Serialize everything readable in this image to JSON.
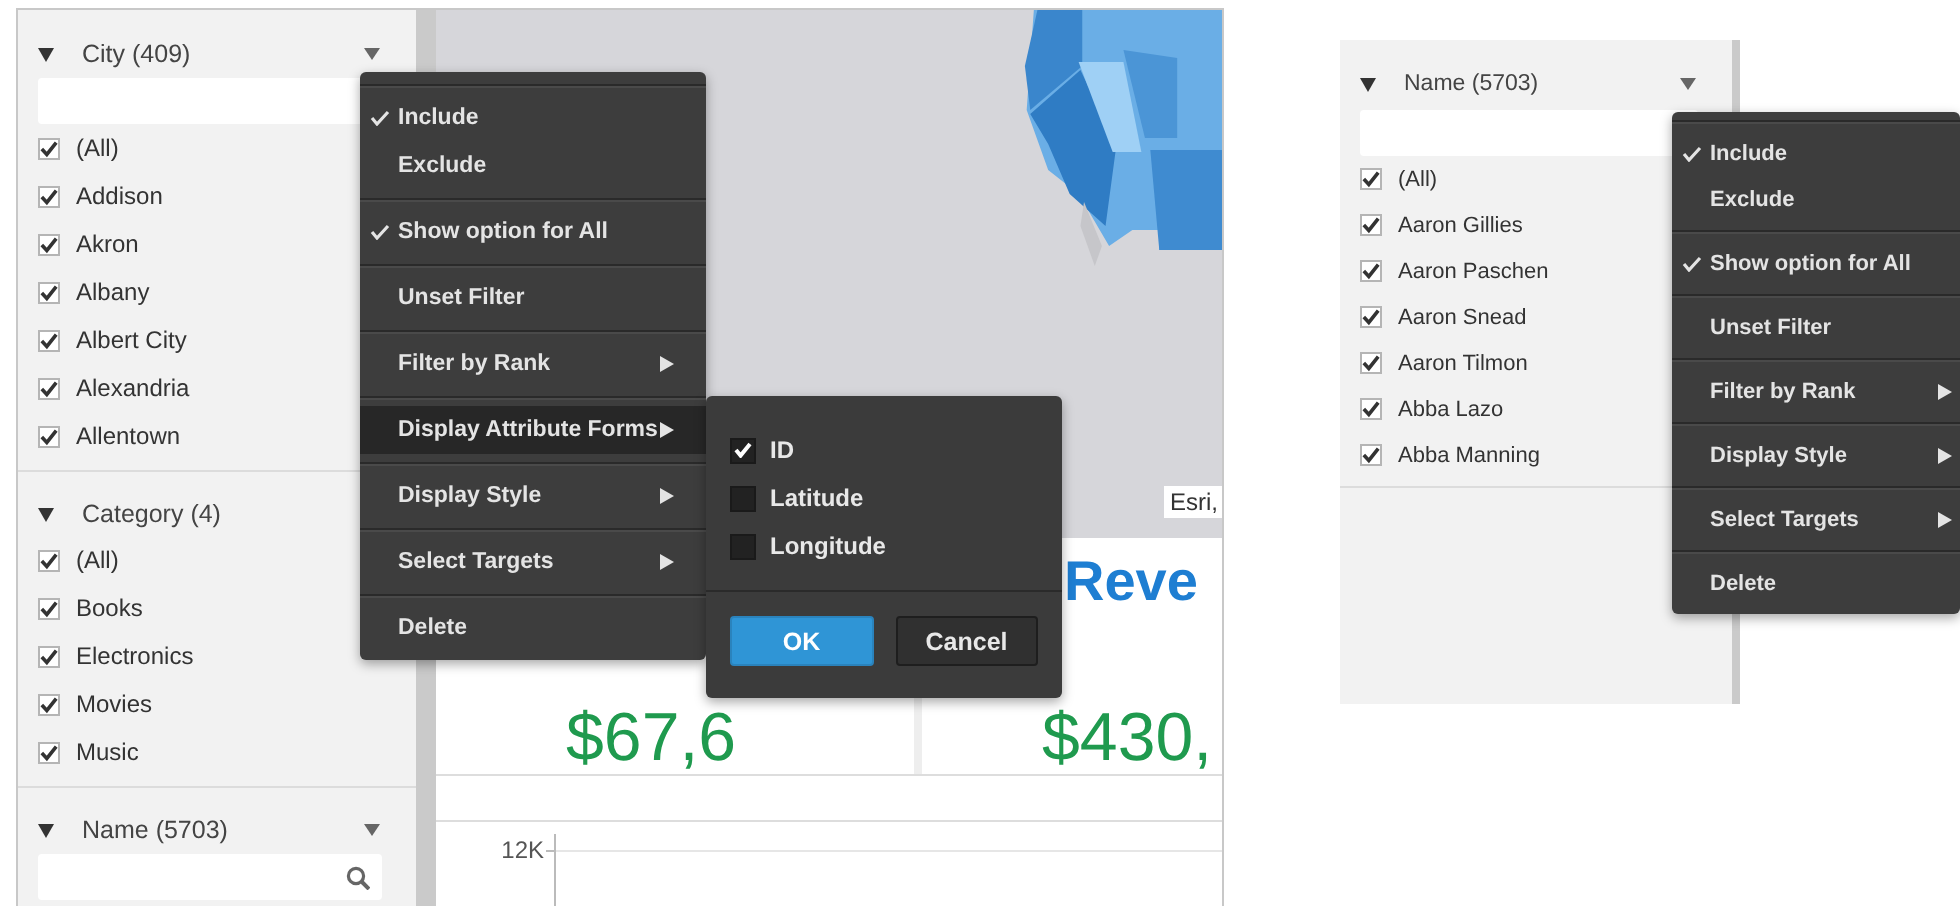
{
  "left_window": {
    "sidebar": {
      "sections": [
        {
          "title": "City (409)",
          "caret": true,
          "search": {
            "magnifier": false
          },
          "items": [
            {
              "label": "(All)",
              "checked": true
            },
            {
              "label": "Addison",
              "checked": true
            },
            {
              "label": "Akron",
              "checked": true
            },
            {
              "label": "Albany",
              "checked": true
            },
            {
              "label": "Albert City",
              "checked": true
            },
            {
              "label": "Alexandria",
              "checked": true
            },
            {
              "label": "Allentown",
              "checked": true
            }
          ]
        },
        {
          "title": "Category (4)",
          "caret": false,
          "items": [
            {
              "label": "(All)",
              "checked": true
            },
            {
              "label": "Books",
              "checked": true
            },
            {
              "label": "Electronics",
              "checked": true
            },
            {
              "label": "Movies",
              "checked": true
            },
            {
              "label": "Music",
              "checked": true
            }
          ]
        },
        {
          "title": "Name (5703)",
          "caret": true,
          "search": {
            "magnifier": true
          }
        }
      ]
    },
    "map": {
      "attribution": "Esri,"
    },
    "kpis": [
      {
        "value": "$67,6"
      },
      {
        "title": "Reve",
        "value": "$430,"
      }
    ],
    "chart": {
      "tick_label": "12K"
    },
    "context_menu": {
      "groups": [
        [
          {
            "kind": "check",
            "label": "Include",
            "checked": true,
            "selected": false
          },
          {
            "kind": "check",
            "label": "Exclude",
            "checked": false,
            "selected": false
          }
        ],
        [
          {
            "kind": "check",
            "label": "Show option for All",
            "checked": true,
            "selected": false
          }
        ],
        [
          {
            "kind": "action",
            "label": "Unset Filter",
            "selected": false
          }
        ],
        [
          {
            "kind": "submenu",
            "label": "Filter by Rank",
            "selected": false
          }
        ],
        [
          {
            "kind": "submenu",
            "label": "Display Attribute Forms",
            "selected": true
          }
        ],
        [
          {
            "kind": "submenu",
            "label": "Display Style",
            "selected": false
          }
        ],
        [
          {
            "kind": "submenu",
            "label": "Select Targets",
            "selected": false
          }
        ],
        [
          {
            "kind": "action",
            "label": "Delete",
            "selected": false
          }
        ]
      ]
    },
    "submenu": {
      "options": [
        {
          "label": "ID",
          "checked": true
        },
        {
          "label": "Latitude",
          "checked": false
        },
        {
          "label": "Longitude",
          "checked": false
        }
      ],
      "buttons": [
        {
          "kind": "primary",
          "label": "OK"
        },
        {
          "kind": "secondary",
          "label": "Cancel"
        }
      ]
    }
  },
  "right_window": {
    "sidebar": {
      "sections": [
        {
          "title": "Name (5703)",
          "caret": true,
          "search": {
            "magnifier": false
          },
          "items": [
            {
              "label": "(All)",
              "checked": true
            },
            {
              "label": "Aaron Gillies",
              "checked": true
            },
            {
              "label": "Aaron Paschen",
              "checked": true
            },
            {
              "label": "Aaron Snead",
              "checked": true
            },
            {
              "label": "Aaron Tilmon",
              "checked": true
            },
            {
              "label": "Abba Lazo",
              "checked": true
            },
            {
              "label": "Abba Manning",
              "checked": true
            }
          ]
        }
      ]
    },
    "context_menu": {
      "groups": [
        [
          {
            "kind": "check",
            "label": "Include",
            "checked": true,
            "selected": false
          },
          {
            "kind": "check",
            "label": "Exclude",
            "checked": false,
            "selected": false
          }
        ],
        [
          {
            "kind": "check",
            "label": "Show option for All",
            "checked": true,
            "selected": false
          }
        ],
        [
          {
            "kind": "action",
            "label": "Unset Filter",
            "selected": false
          }
        ],
        [
          {
            "kind": "submenu",
            "label": "Filter by Rank",
            "selected": false
          }
        ],
        [
          {
            "kind": "submenu",
            "label": "Display Style",
            "selected": false
          }
        ],
        [
          {
            "kind": "submenu",
            "label": "Select Targets",
            "selected": false
          }
        ],
        [
          {
            "kind": "action",
            "label": "Delete",
            "selected": false
          }
        ]
      ]
    }
  }
}
